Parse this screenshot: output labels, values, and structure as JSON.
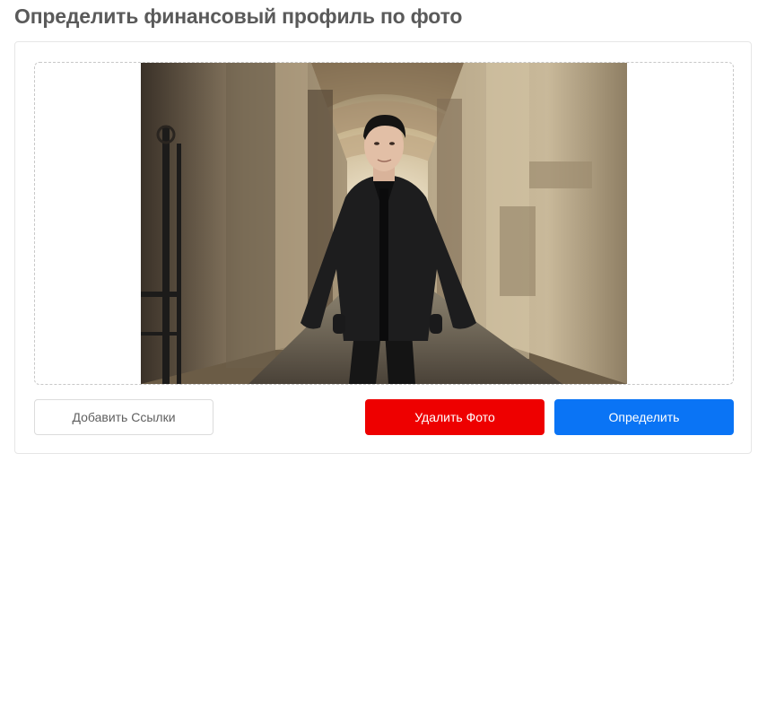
{
  "page": {
    "title": "Определить финансовый профиль по фото"
  },
  "upload": {
    "photo_alt": "Фото",
    "photo_icon": "uploaded-photo"
  },
  "actions": {
    "add_links_label": "Добавить Ссылки",
    "delete_photo_label": "Удалить Фото",
    "detect_label": "Определить"
  },
  "colors": {
    "title_text": "#5a5a5a",
    "delete_button": "#ee0000",
    "detect_button": "#0a74f5",
    "card_border": "#e6e6e6"
  }
}
